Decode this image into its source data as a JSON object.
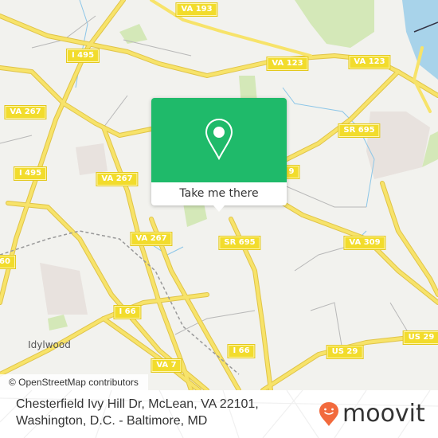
{
  "map": {
    "background_color": "#f2f2ee",
    "road_color": "#f7e36a",
    "water_color": "#a8d3ea",
    "park_color": "#d4e8b8",
    "road_shields": [
      {
        "id": "va193",
        "label": "VA 193"
      },
      {
        "id": "i495-top",
        "label": "I 495"
      },
      {
        "id": "va123-left",
        "label": "VA 123"
      },
      {
        "id": "va123-right",
        "label": "VA 123"
      },
      {
        "id": "va267-left",
        "label": "VA 267"
      },
      {
        "id": "sr695-top",
        "label": "SR 695"
      },
      {
        "id": "i495-left",
        "label": "I 495"
      },
      {
        "id": "va267-mid",
        "label": "VA 267"
      },
      {
        "id": "shield-9-partial",
        "label": "9"
      },
      {
        "id": "va267-lower",
        "label": "VA 267"
      },
      {
        "id": "sr695-mid",
        "label": "SR 695"
      },
      {
        "id": "va309",
        "label": "VA 309"
      },
      {
        "id": "shield-60-partial",
        "label": "60"
      },
      {
        "id": "i66-left",
        "label": "I 66"
      },
      {
        "id": "i66-right",
        "label": "I 66"
      },
      {
        "id": "us29-right",
        "label": "US 29"
      },
      {
        "id": "us29-mid",
        "label": "US 29"
      },
      {
        "id": "va7",
        "label": "VA 7"
      }
    ],
    "place_labels": [
      {
        "id": "idylwood",
        "label": "Idylwood"
      }
    ],
    "attribution": "© OpenStreetMap contributors"
  },
  "popup": {
    "accent_color": "#1fba6a",
    "icon": "map-pin-icon",
    "button_label": "Take me there"
  },
  "footer": {
    "address_line1": "Chesterfield Ivy Hill Dr, McLean, VA 22101,",
    "address_line2": "Washington, D.C. - Baltimore, MD",
    "logo_text": "moovit",
    "logo_color": "#f26a3d"
  }
}
